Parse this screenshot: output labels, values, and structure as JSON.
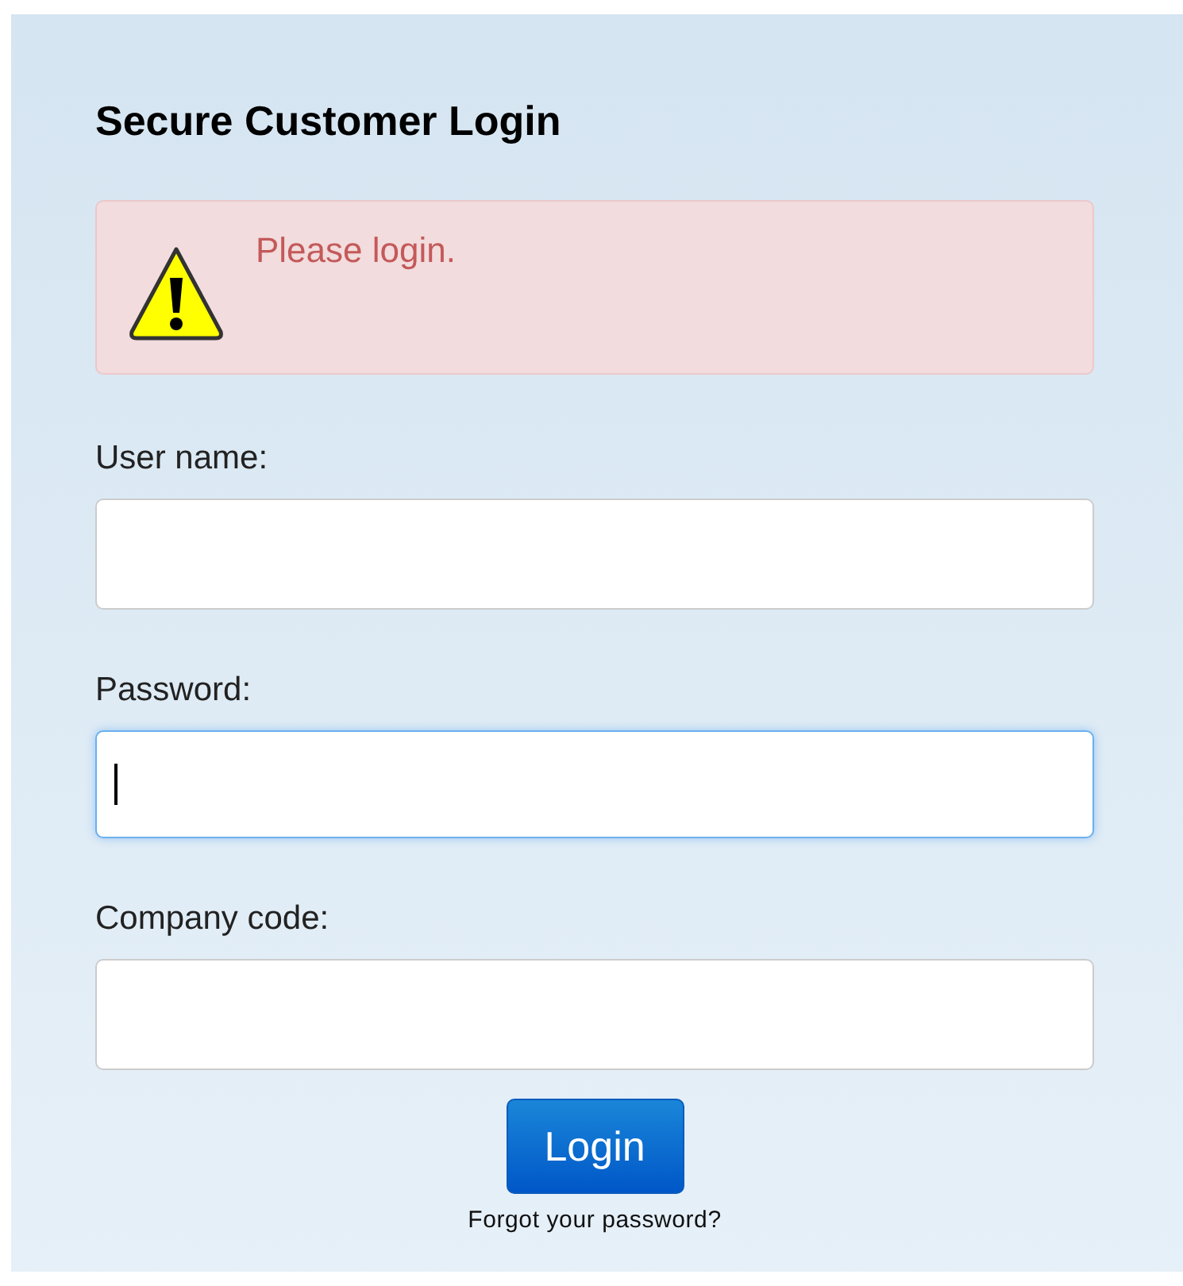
{
  "title": "Secure Customer Login",
  "alert": {
    "message": "Please login."
  },
  "fields": [
    {
      "label": "User name:",
      "focused": false
    },
    {
      "label": "Password:",
      "focused": true
    },
    {
      "label": "Company code:",
      "focused": false
    }
  ],
  "login_button": "Login",
  "forgot_link": "Forgot your password?"
}
